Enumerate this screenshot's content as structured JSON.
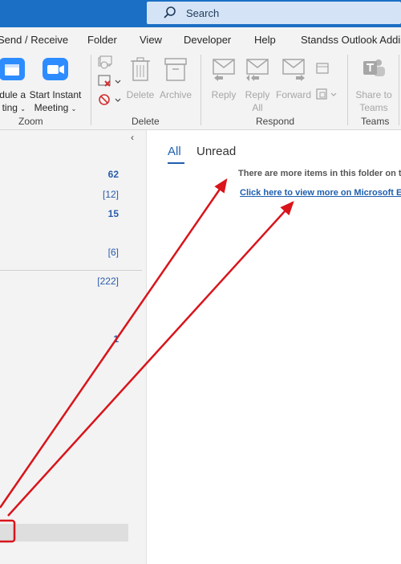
{
  "search": {
    "label": "Search"
  },
  "menu": {
    "items": [
      "Send / Receive",
      "Folder",
      "View",
      "Developer",
      "Help",
      "Standss Outlook Addins"
    ],
    "display": [
      "Send / Receive",
      "Folder",
      "View",
      "Developer",
      "Help",
      "Standss Outlook Addi"
    ]
  },
  "ribbon": {
    "zoom": {
      "schedule_line1": "dule a",
      "schedule_line2": "ting",
      "instant_line1": "Start Instant",
      "instant_line2": "Meeting",
      "label": "Zoom"
    },
    "delete": {
      "delete_label": "Delete",
      "archive_label": "Archive",
      "label": "Delete"
    },
    "respond": {
      "reply": "Reply",
      "reply_all_line1": "Reply",
      "reply_all_line2": "All",
      "forward": "Forward",
      "label": "Respond"
    },
    "teams": {
      "share_line1": "Share to",
      "share_line2": "Teams",
      "label": "Teams"
    }
  },
  "folders": {
    "counts": [
      "62",
      "[12]",
      "15",
      "[6]",
      "[222]",
      "1"
    ]
  },
  "message_list": {
    "tabs": [
      "All",
      "Unread"
    ],
    "info": "There are more items in this folder on the server",
    "info_display": "There are more items in this folder on th",
    "link": "Click here to view more on Microsoft Exchange",
    "link_display": "Click here to view more on Microsoft E"
  },
  "colors": {
    "title_bar": "#1b6fc4",
    "accent": "#1f5fae",
    "annotation": "#d9141b",
    "zoom_icon": "#2d8cff"
  }
}
